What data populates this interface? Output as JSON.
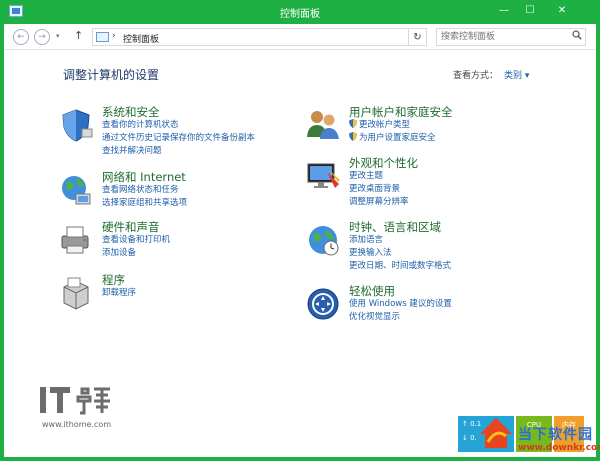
{
  "window": {
    "title": "控制面板",
    "minimize_glyph": "—",
    "maximize_glyph": "☐",
    "close_glyph": "✕"
  },
  "nav": {
    "back_glyph": "←",
    "forward_glyph": "→",
    "history_glyph": "▾",
    "up_glyph": "↑",
    "refresh_glyph": "↻",
    "path_separator": "›",
    "path_dropdown_glyph": "▾"
  },
  "address": {
    "path": "控制面板"
  },
  "search": {
    "placeholder": "搜索控制面板"
  },
  "content": {
    "title": "调整计算机的设置",
    "view_by_label": "查看方式：",
    "view_by_value": "类别 ▾"
  },
  "categories": {
    "system": {
      "title": "系统和安全",
      "links": [
        "查看你的计算机状态",
        "通过文件历史记录保存你的文件备份副本",
        "查找并解决问题"
      ]
    },
    "network": {
      "title": "网络和 Internet",
      "links": [
        "查看网络状态和任务",
        "选择家庭组和共享选项"
      ]
    },
    "hardware": {
      "title": "硬件和声音",
      "links": [
        "查看设备和打印机",
        "添加设备"
      ]
    },
    "programs": {
      "title": "程序",
      "links": [
        "卸载程序"
      ]
    },
    "users": {
      "title": "用户帐户和家庭安全",
      "links": [
        "更改帐户类型",
        "为用户设置家庭安全"
      ]
    },
    "appearance": {
      "title": "外观和个性化",
      "links": [
        "更改主题",
        "更改桌面背景",
        "调整屏幕分辨率"
      ]
    },
    "clock": {
      "title": "时钟、语言和区域",
      "links": [
        "添加语言",
        "更换输入法",
        "更改日期、时间或数字格式"
      ]
    },
    "ease": {
      "title": "轻松使用",
      "links": [
        "使用 Windows 建议的设置",
        "优化视觉显示"
      ]
    }
  },
  "watermark": {
    "url": "www.ithome.com"
  },
  "overlay": {
    "net_up": "0.1",
    "net_down": "0.",
    "cpu_label": "CPU",
    "mem_label": "内存",
    "site_name": "当下软件园",
    "site_url": "www.downkr.com"
  },
  "colors": {
    "window_border": "#1fb043",
    "category_title": "#1f6c2f",
    "link": "#1e5fa8",
    "page_title": "#1f3a68"
  }
}
